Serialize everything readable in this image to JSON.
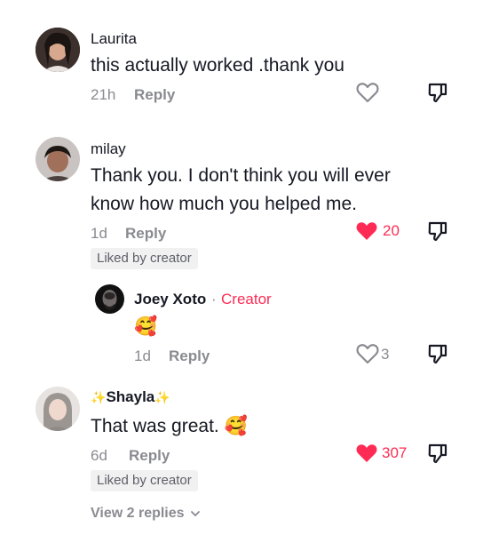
{
  "comments": [
    {
      "username": "Laurita",
      "text": "this actually worked .thank you",
      "time": "21h",
      "reply_label": "Reply",
      "liked": false,
      "like_count": ""
    },
    {
      "username": "milay",
      "text_line1": "Thank you. I don't think you will ever",
      "text_line2": "know how much you helped me.",
      "time": "1d",
      "reply_label": "Reply",
      "liked": true,
      "like_count": "20",
      "badge": "Liked by creator",
      "reply": {
        "username": "Joey Xoto",
        "separator": "·",
        "creator_label": "Creator",
        "emoji": "🥰",
        "time": "1d",
        "reply_label": "Reply",
        "like_count": "3"
      }
    },
    {
      "username_prefix": "✨",
      "username": "Shayla",
      "username_suffix": "✨",
      "text": "That was great.",
      "emoji": "🥰",
      "time": "6d",
      "reply_label": "Reply",
      "liked": true,
      "like_count": "307",
      "badge": "Liked by creator",
      "view_replies": "View 2 replies"
    }
  ],
  "colors": {
    "accent": "#fe2c55",
    "secondary_text": "#8a8b91",
    "badge_bg": "#f1f1f2"
  }
}
